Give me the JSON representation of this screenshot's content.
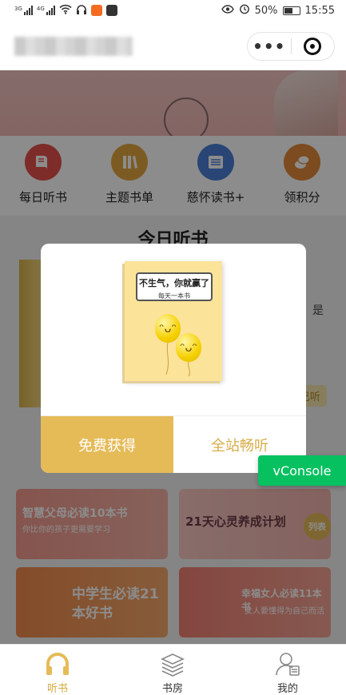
{
  "status_bar": {
    "signal_1": "3G",
    "signal_2": "4G",
    "battery": "50%",
    "time": "15:55"
  },
  "capsule": {
    "more": "•••"
  },
  "menu": [
    {
      "label": "每日听书",
      "icon": "book-icon",
      "color": "#e4514d"
    },
    {
      "label": "主题书单",
      "icon": "books-icon",
      "color": "#e2a640"
    },
    {
      "label": "慈怀读书+",
      "icon": "list-icon",
      "color": "#4a7fd6"
    },
    {
      "label": "领积分",
      "icon": "coins-icon",
      "color": "#e2893a"
    }
  ],
  "section": {
    "title": "今日听书",
    "side_text": "是",
    "chip": "已听"
  },
  "modal": {
    "cover_title": "不生气，你就赢了",
    "cover_subtitle": "每天一本书",
    "primary_button": "免费获得",
    "secondary_button": "全站畅听"
  },
  "vconsole": "vConsole",
  "cards": [
    {
      "title": "智慧父母必读10本书",
      "subtitle": "你比你的孩子更需要学习"
    },
    {
      "title": "21天心灵养成计划",
      "badge": "列表"
    },
    {
      "title": "中学生必读21本好书"
    },
    {
      "title": "幸福女人必读11本书",
      "subtitle": "女人要懂得为自己而活"
    }
  ],
  "tabs": [
    {
      "label": "听书",
      "icon": "headphones-icon",
      "active": true
    },
    {
      "label": "书房",
      "icon": "bookshelf-icon",
      "active": false
    },
    {
      "label": "我的",
      "icon": "profile-icon",
      "active": false
    }
  ],
  "colors": {
    "accent": "#e5bb58",
    "vconsole": "#07c160"
  }
}
